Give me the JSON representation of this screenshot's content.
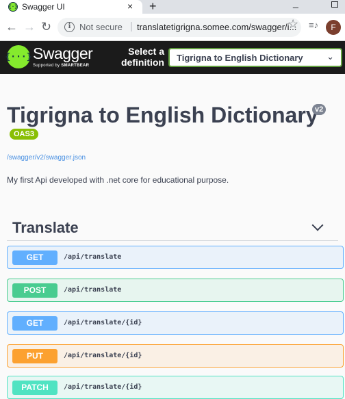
{
  "browser": {
    "tab_title": "Swagger UI",
    "tab_close": "×",
    "new_tab": "+",
    "not_secure": "Not secure",
    "url": "translatetigrigna.somee.com/swagger/i...",
    "avatar_letter": "F"
  },
  "topbar": {
    "logo_text": "Swagger",
    "logo_sub_prefix": "Supported by ",
    "logo_sub_brand": "SMARTBEAR",
    "select_label": "Select a definition",
    "selected_definition": "Tigrigna to English Dictionary"
  },
  "info": {
    "title": "Tigrigna to English Dictionary",
    "version_badge": "v2",
    "oas_badge": "OAS3",
    "spec_link": "/swagger/v2/swagger.json",
    "description": "My first Api developed with .net core for educational purpose."
  },
  "tag": {
    "name": "Translate"
  },
  "operations": [
    {
      "method": "GET",
      "path": "/api/translate"
    },
    {
      "method": "POST",
      "path": "/api/translate"
    },
    {
      "method": "GET",
      "path": "/api/translate/{id}"
    },
    {
      "method": "PUT",
      "path": "/api/translate/{id}"
    },
    {
      "method": "PATCH",
      "path": "/api/translate/{id}"
    }
  ],
  "colors": {
    "get": "#61affe",
    "post": "#49cc90",
    "put": "#fca130",
    "patch": "#50e3c2",
    "topbar_bg": "#1b1b1b",
    "brand_green": "#85ea2d",
    "oas_green": "#89bf04"
  }
}
